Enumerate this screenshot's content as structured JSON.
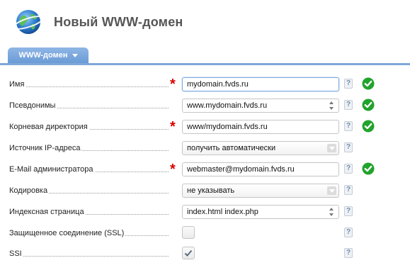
{
  "page": {
    "title": "Новый WWW-домен",
    "icon": "globe-icon"
  },
  "tabs": [
    {
      "label": "WWW-домен",
      "icon": "chevron-down-icon"
    }
  ],
  "colors": {
    "accent": "#7fa7d8",
    "required": "#d80000",
    "ok": "#22a32c"
  },
  "form": {
    "fields": [
      {
        "label": "Имя",
        "required": true,
        "type": "text",
        "value": "mydomain.fvds.ru",
        "focused": true,
        "valid": true
      },
      {
        "label": "Псевдонимы",
        "required": false,
        "type": "multiline",
        "value": "www.mydomain.fvds.ru",
        "valid": true
      },
      {
        "label": "Корневая директория",
        "required": true,
        "type": "text",
        "value": "www/mydomain.fvds.ru",
        "valid": true
      },
      {
        "label": "Источник IP-адреса",
        "required": false,
        "type": "select",
        "value": "получить автоматически",
        "valid": false
      },
      {
        "label": "E-Mail администратора",
        "required": true,
        "type": "text",
        "value": "webmaster@mydomain.fvds.ru",
        "valid": true
      },
      {
        "label": "Кодировка",
        "required": false,
        "type": "select",
        "value": "не указывать",
        "valid": false
      },
      {
        "label": "Индексная страница",
        "required": false,
        "type": "multiline",
        "value": "index.html index.php",
        "valid": false
      },
      {
        "label": "Защищенное соединение (SSL)",
        "required": false,
        "type": "checkbox",
        "checked": false,
        "valid": false
      },
      {
        "label": "SSI",
        "required": false,
        "type": "checkbox",
        "checked": true,
        "valid": false
      }
    ],
    "help_label": "?",
    "required_mark": "*"
  }
}
